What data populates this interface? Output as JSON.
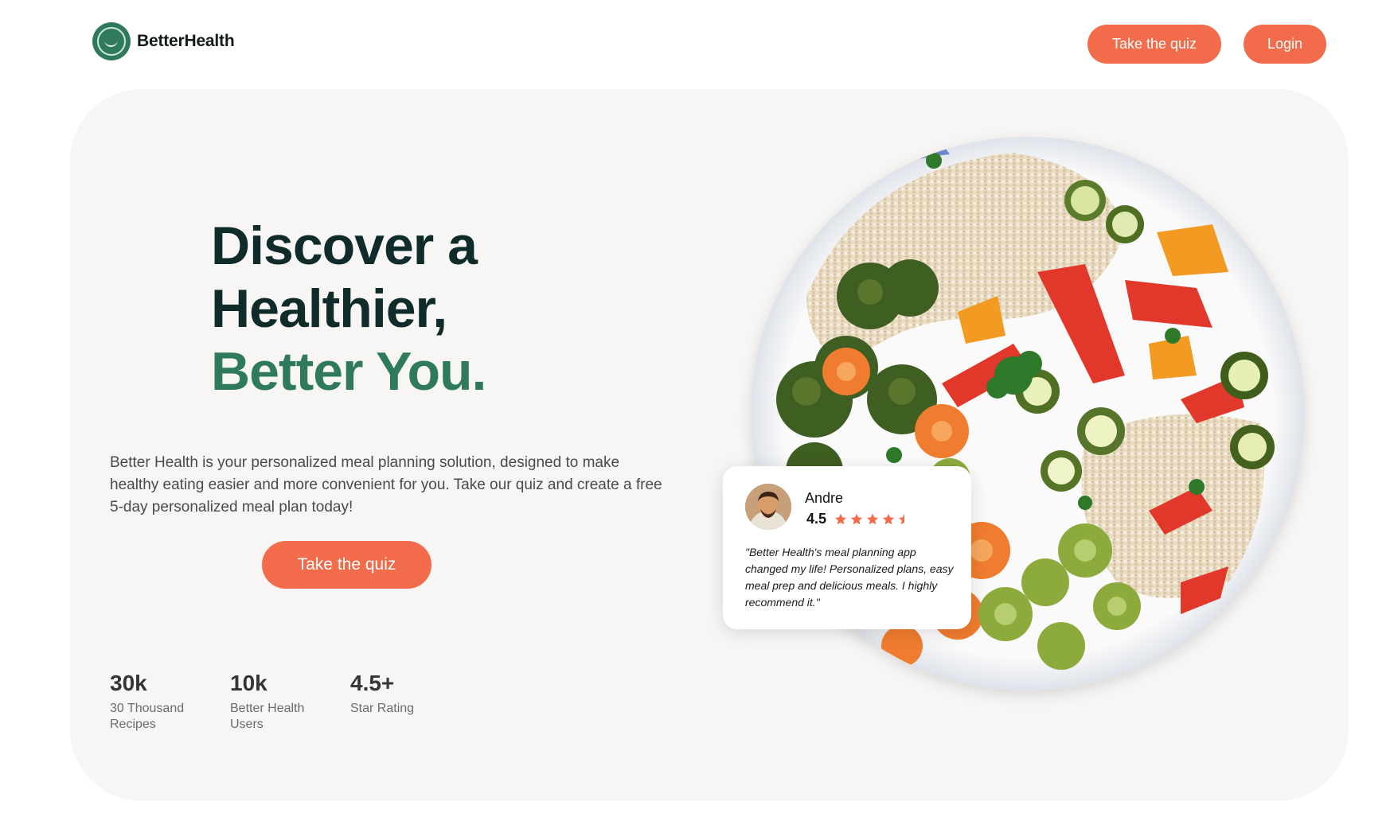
{
  "brand": {
    "name": "BetterHealth",
    "icon": "smile-logo-icon",
    "color": "#2f7a5a"
  },
  "nav": {
    "quiz_label": "Take the quiz",
    "login_label": "Login"
  },
  "colors": {
    "accent": "#f26b4a",
    "heading": "#0f2b2a",
    "highlight": "#2f7a5a",
    "hero_bg": "#f8f6f4"
  },
  "hero": {
    "headline_line1": "Discover a",
    "headline_line2": "Healthier,",
    "headline_accent": "Better You.",
    "description": "Better Health is your personalized meal planning solution, designed to make healthy eating easier and more convenient for you. Take our quiz and create a free 5-day personalized meal plan today!",
    "cta_label": "Take the quiz"
  },
  "stats": [
    {
      "value": "30k",
      "label": "30 Thousand Recipes"
    },
    {
      "value": "10k",
      "label": "Better Health Users"
    },
    {
      "value": "4.5+",
      "label": "Star Rating"
    }
  ],
  "image": {
    "icon": "salad-bowl-illustration"
  },
  "review": {
    "name": "Andre",
    "rating": "4.5",
    "stars_filled": 4.5,
    "stars_total": 5,
    "star_icon": "star-icon",
    "quote": "\"Better Health's meal planning app changed my life! Personalized plans, easy meal prep and delicious meals. I highly recommend it.\""
  }
}
